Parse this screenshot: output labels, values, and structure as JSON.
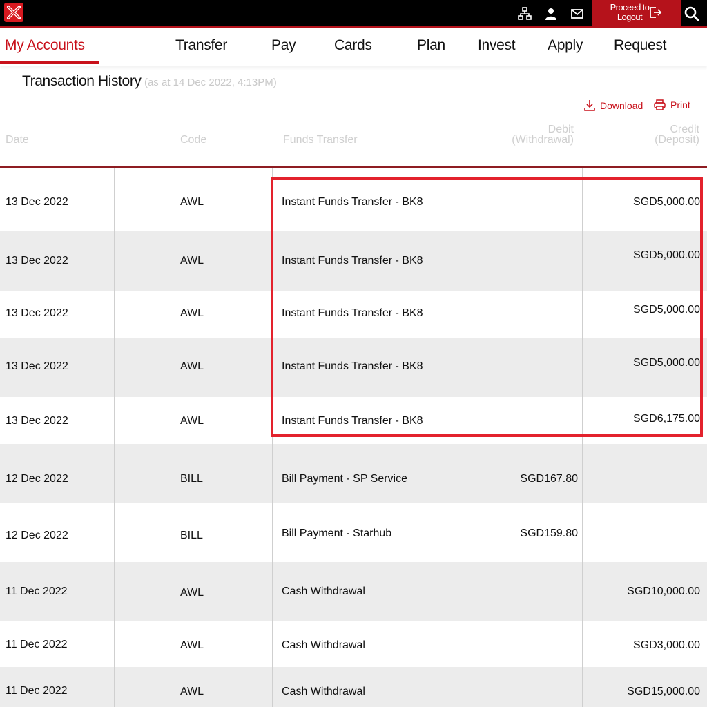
{
  "topbar": {
    "logout_line1": "Proceed to",
    "logout_line2": "Logout",
    "icons": [
      "sitemap-icon",
      "user-icon",
      "mail-icon",
      "logout-icon",
      "search-icon"
    ]
  },
  "nav": {
    "items": [
      {
        "label": "My Accounts",
        "active": true
      },
      {
        "label": "Transfer"
      },
      {
        "label": "Pay"
      },
      {
        "label": "Cards"
      },
      {
        "label": "Plan"
      },
      {
        "label": "Invest"
      },
      {
        "label": "Apply"
      },
      {
        "label": "Request"
      }
    ]
  },
  "page": {
    "title": "Transaction History",
    "subtitle": "(as at 14 Dec 2022, 4:13PM)",
    "download_label": "Download",
    "print_label": "Print"
  },
  "table": {
    "headers": {
      "date": "Date",
      "code": "Code",
      "description": "Funds Transfer",
      "debit_line1": "Debit",
      "debit_line2": "(Withdrawal)",
      "credit_line1": "Credit",
      "credit_line2": "(Deposit)"
    },
    "rows": [
      {
        "date": "13 Dec 2022",
        "code": "AWL",
        "description": "Instant Funds Transfer - BK8",
        "debit": "",
        "credit": "SGD5,000.00"
      },
      {
        "date": "13 Dec 2022",
        "code": "AWL",
        "description": "Instant Funds Transfer - BK8",
        "debit": "",
        "credit": "SGD5,000.00"
      },
      {
        "date": "13 Dec 2022",
        "code": "AWL",
        "description": "Instant Funds Transfer - BK8",
        "debit": "",
        "credit": "SGD5,000.00"
      },
      {
        "date": "13 Dec 2022",
        "code": "AWL",
        "description": "Instant Funds Transfer - BK8",
        "debit": "",
        "credit": "SGD5,000.00"
      },
      {
        "date": "13 Dec 2022",
        "code": "AWL",
        "description": "Instant Funds Transfer - BK8",
        "debit": "",
        "credit": "SGD6,175.00"
      },
      {
        "date": "12 Dec 2022",
        "code": "BILL",
        "description": "Bill Payment - SP Service",
        "debit": "SGD167.80",
        "credit": ""
      },
      {
        "date": "12 Dec 2022",
        "code": "BILL",
        "description": "Bill Payment - Starhub",
        "debit": "SGD159.80",
        "credit": ""
      },
      {
        "date": "11 Dec 2022",
        "code": "AWL",
        "description": "Cash Withdrawal",
        "debit": "",
        "credit": "SGD10,000.00"
      },
      {
        "date": "11 Dec 2022",
        "code": "AWL",
        "description": "Cash Withdrawal",
        "debit": "",
        "credit": "SGD3,000.00"
      },
      {
        "date": "11 Dec 2022",
        "code": "AWL",
        "description": "Cash Withdrawal",
        "debit": "",
        "credit": "SGD15,000.00"
      }
    ]
  },
  "colors": {
    "brand_red": "#c8101a",
    "highlight_red": "#e3222d",
    "header_rule": "#8e1c22",
    "row_shade": "#ececec"
  }
}
